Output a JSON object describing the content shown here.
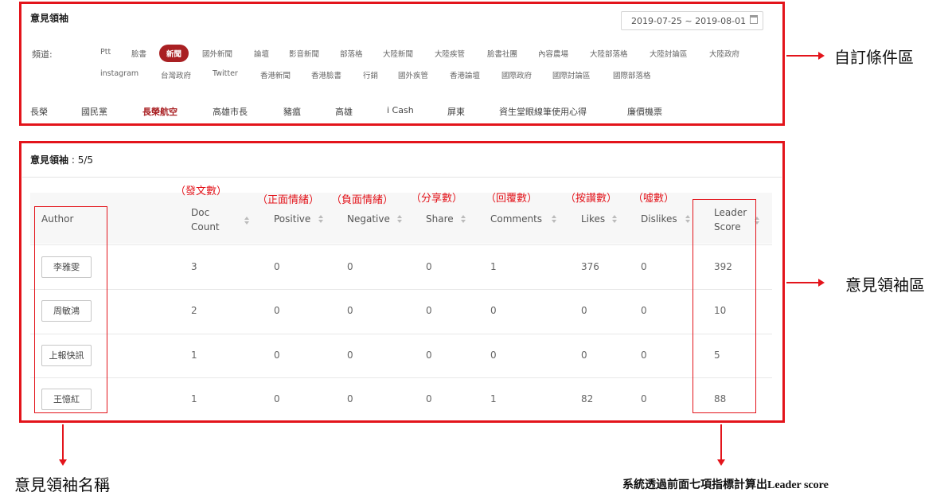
{
  "filter_panel": {
    "title": "意見領袖",
    "date_range": "2019-07-25 ~ 2019-08-01",
    "channel_label": "頻道:",
    "channels_row1": [
      "Ptt",
      "臉書",
      "新聞",
      "國外新聞",
      "論壇",
      "影音新聞",
      "部落格",
      "大陸新聞",
      "大陸疾管",
      "臉書社團",
      "內容農場",
      "大陸部落格",
      "大陸討論區",
      "大陸政府"
    ],
    "channels_row2": [
      "instagram",
      "台灣政府",
      "Twitter",
      "香港新聞",
      "香港臉書",
      "行銷",
      "國外疾管",
      "香港論壇",
      "國際政府",
      "國際討論區",
      "國際部落格"
    ],
    "active_channel": "新聞",
    "keywords": [
      "長榮",
      "國民黨",
      "長榮航空",
      "高雄市長",
      "豬瘟",
      "高雄",
      "i Cash",
      "屏東",
      "資生堂眼線筆使用心得",
      "廉價機票"
    ],
    "active_keyword": "長榮航空"
  },
  "leader_panel": {
    "title": "意見領袖",
    "count": " : 5/5",
    "columns": {
      "author": "Author",
      "doc1": "Doc",
      "doc2": "Count",
      "positive": "Positive",
      "negative": "Negative",
      "share": "Share",
      "comments": "Comments",
      "likes": "Likes",
      "dislikes": "Dislikes",
      "leader1": "Leader",
      "leader2": "Score"
    },
    "rows": [
      {
        "author": "李雅雯",
        "doc": "3",
        "pos": "0",
        "neg": "0",
        "share": "0",
        "comments": "1",
        "likes": "376",
        "dislikes": "0",
        "score": "392"
      },
      {
        "author": "周敏鴻",
        "doc": "2",
        "pos": "0",
        "neg": "0",
        "share": "0",
        "comments": "0",
        "likes": "0",
        "dislikes": "0",
        "score": "10"
      },
      {
        "author": "上報快訊",
        "doc": "1",
        "pos": "0",
        "neg": "0",
        "share": "0",
        "comments": "0",
        "likes": "0",
        "dislikes": "0",
        "score": "5"
      },
      {
        "author": "王憶紅",
        "doc": "1",
        "pos": "0",
        "neg": "0",
        "share": "0",
        "comments": "1",
        "likes": "82",
        "dislikes": "0",
        "score": "88"
      }
    ]
  },
  "annotations": {
    "doc_count": "（發文數）",
    "positive": "（正面情緒）",
    "negative": "（負面情緒）",
    "share": "（分享數）",
    "comments": "（回覆數）",
    "likes": "（按讚數）",
    "dislikes": "（噓數）",
    "filter_area": "自訂條件區",
    "leader_area": "意見領袖區",
    "author_name": "意見領袖名稱",
    "score_note": "系統透過前面七項指標計算出Leader score"
  },
  "colors": {
    "annotation_red": "#e3141b",
    "active_brand": "#a92023"
  }
}
